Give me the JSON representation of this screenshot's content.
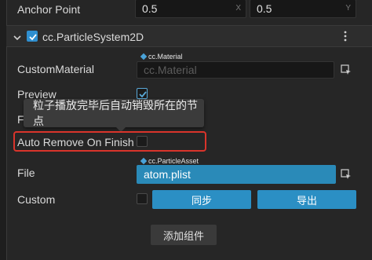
{
  "anchor_point": {
    "label": "Anchor Point",
    "x_value": "0.5",
    "x_axis": "X",
    "y_value": "0.5",
    "y_axis": "Y"
  },
  "component": {
    "title": "cc.ParticleSystem2D",
    "menu_icon": "kebab-menu-icon"
  },
  "custom_material": {
    "label": "CustomMaterial",
    "tag": "cc.Material",
    "placeholder": "cc.Material"
  },
  "preview": {
    "label": "Preview"
  },
  "hidden_row_label": "F",
  "tooltip": {
    "text": "粒子播放完毕后自动销毁所在的节点"
  },
  "auto_remove": {
    "label": "Auto Remove On Finish"
  },
  "file": {
    "label": "File",
    "tag": "cc.ParticleAsset",
    "value": "atom.plist"
  },
  "custom": {
    "label": "Custom",
    "sync_button": "同步",
    "export_button": "导出"
  },
  "add_component_button": "添加组件",
  "colors": {
    "accent": "#2b8fc4",
    "highlight": "#d9342b"
  }
}
